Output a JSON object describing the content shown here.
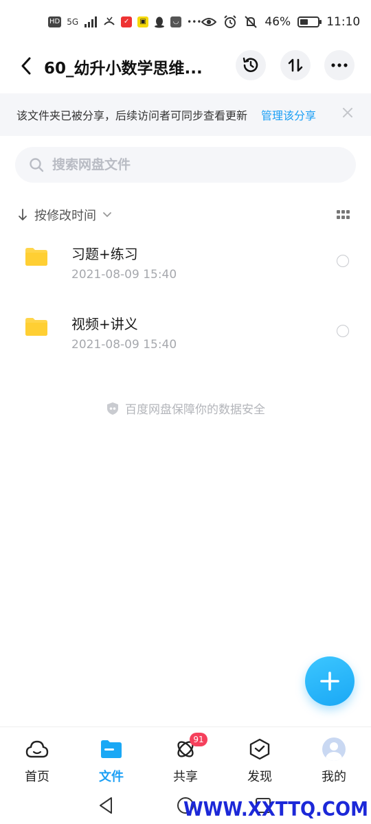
{
  "status_bar": {
    "hd": "HD",
    "signal": "5G",
    "eye_icon": "eye-icon",
    "battery_percent": "46%",
    "battery_level": 0.46,
    "time": "11:10"
  },
  "header": {
    "title": "60_幼升小数学思维...",
    "icons": [
      "back-arrow-icon",
      "history-icon",
      "sort-transfer-icon",
      "more-icon"
    ]
  },
  "banner": {
    "text": "该文件夹已被分享，后续访问者可同步查看更新",
    "link": "管理该分享"
  },
  "search": {
    "placeholder": "搜索网盘文件"
  },
  "sort": {
    "label": "按修改时间"
  },
  "files": [
    {
      "name": "习题+练习",
      "date": "2021-08-09  15:40"
    },
    {
      "name": "视频+讲义",
      "date": "2021-08-09  15:40"
    }
  ],
  "safety_note": "百度网盘保障你的数据安全",
  "bottom_nav": {
    "tabs": [
      {
        "label": "首页",
        "icon": "cloud-icon"
      },
      {
        "label": "文件",
        "icon": "folder-icon"
      },
      {
        "label": "共享",
        "icon": "share-orbit-icon",
        "badge": "91"
      },
      {
        "label": "发现",
        "icon": "cube-icon"
      },
      {
        "label": "我的",
        "icon": "avatar-icon"
      }
    ]
  },
  "watermark": "WWW.XXTTQ.COM",
  "colors": {
    "accent": "#1a9ff5",
    "folder": "#ffd54a",
    "badge": "#f5405c",
    "watermark": "#1c28d8"
  }
}
